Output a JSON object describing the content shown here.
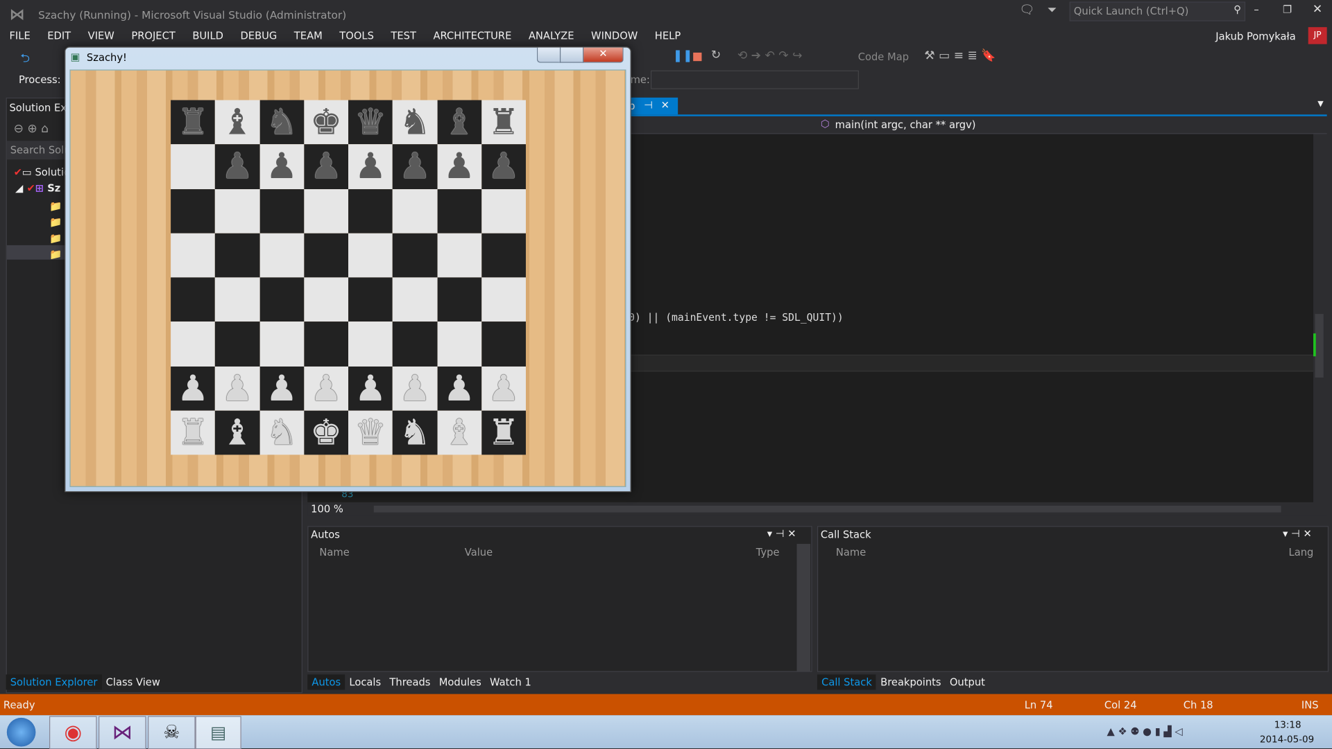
{
  "window": {
    "title": "Szachy (Running) - Microsoft Visual Studio (Administrator)",
    "quick_launch_placeholder": "Quick Launch (Ctrl+Q)",
    "user": "Jakub Pomykała",
    "user_initials": "JP"
  },
  "menu": [
    "FILE",
    "EDIT",
    "VIEW",
    "PROJECT",
    "BUILD",
    "DEBUG",
    "TEAM",
    "TOOLS",
    "TEST",
    "ARCHITECTURE",
    "ANALYZE",
    "WINDOW",
    "HELP"
  ],
  "toolbar": {
    "code_map": "Code Map",
    "process_label": "Process:",
    "frame_label": "me:"
  },
  "solution_explorer": {
    "title": "Solution Exp",
    "search_placeholder": "Search Solu",
    "items": [
      "Solutio",
      "Sz"
    ],
    "tabs": [
      "Solution Explorer",
      "Class View"
    ]
  },
  "editor": {
    "tab_fragment": "p",
    "nav_member": "main(int argc, char ** argv)",
    "code_line": "0) || (mainEvent.type != SDL_QUIT))",
    "line_number": "83",
    "zoom": "100 %"
  },
  "autos": {
    "title": "Autos",
    "columns": [
      "Name",
      "Value",
      "Type"
    ],
    "tabs": [
      "Autos",
      "Locals",
      "Threads",
      "Modules",
      "Watch 1"
    ]
  },
  "callstack": {
    "title": "Call Stack",
    "columns": [
      "Name",
      "Lang"
    ],
    "tabs": [
      "Call Stack",
      "Breakpoints",
      "Output"
    ]
  },
  "status": {
    "ready": "Ready",
    "ln": "Ln 74",
    "col": "Col 24",
    "ch": "Ch 18",
    "ins": "INS",
    "color": "#ca5100"
  },
  "chess_window": {
    "title": "Szachy!",
    "board": [
      [
        "bR",
        "bB",
        "bN",
        "bK",
        "bQ",
        "bN",
        "bB",
        "bR"
      ],
      [
        "",
        "bP",
        "bP",
        "bP",
        "bP",
        "bP",
        "bP",
        "bP"
      ],
      [
        "",
        "",
        "",
        "",
        "",
        "",
        "",
        ""
      ],
      [
        "",
        "",
        "",
        "",
        "",
        "",
        "",
        ""
      ],
      [
        "",
        "",
        "",
        "",
        "",
        "",
        "",
        ""
      ],
      [
        "",
        "",
        "",
        "",
        "",
        "",
        "",
        ""
      ],
      [
        "wP",
        "wP",
        "wP",
        "wP",
        "wP",
        "wP",
        "wP",
        "wP"
      ],
      [
        "wR",
        "wB",
        "wN",
        "wK",
        "wQ",
        "wN",
        "wB",
        "wR"
      ]
    ]
  },
  "taskbar": {
    "apps": [
      "start-orb",
      "chrome",
      "visual-studio",
      "app-fox",
      "szachy-window"
    ],
    "time": "13:18",
    "date": "2014-05-09"
  }
}
